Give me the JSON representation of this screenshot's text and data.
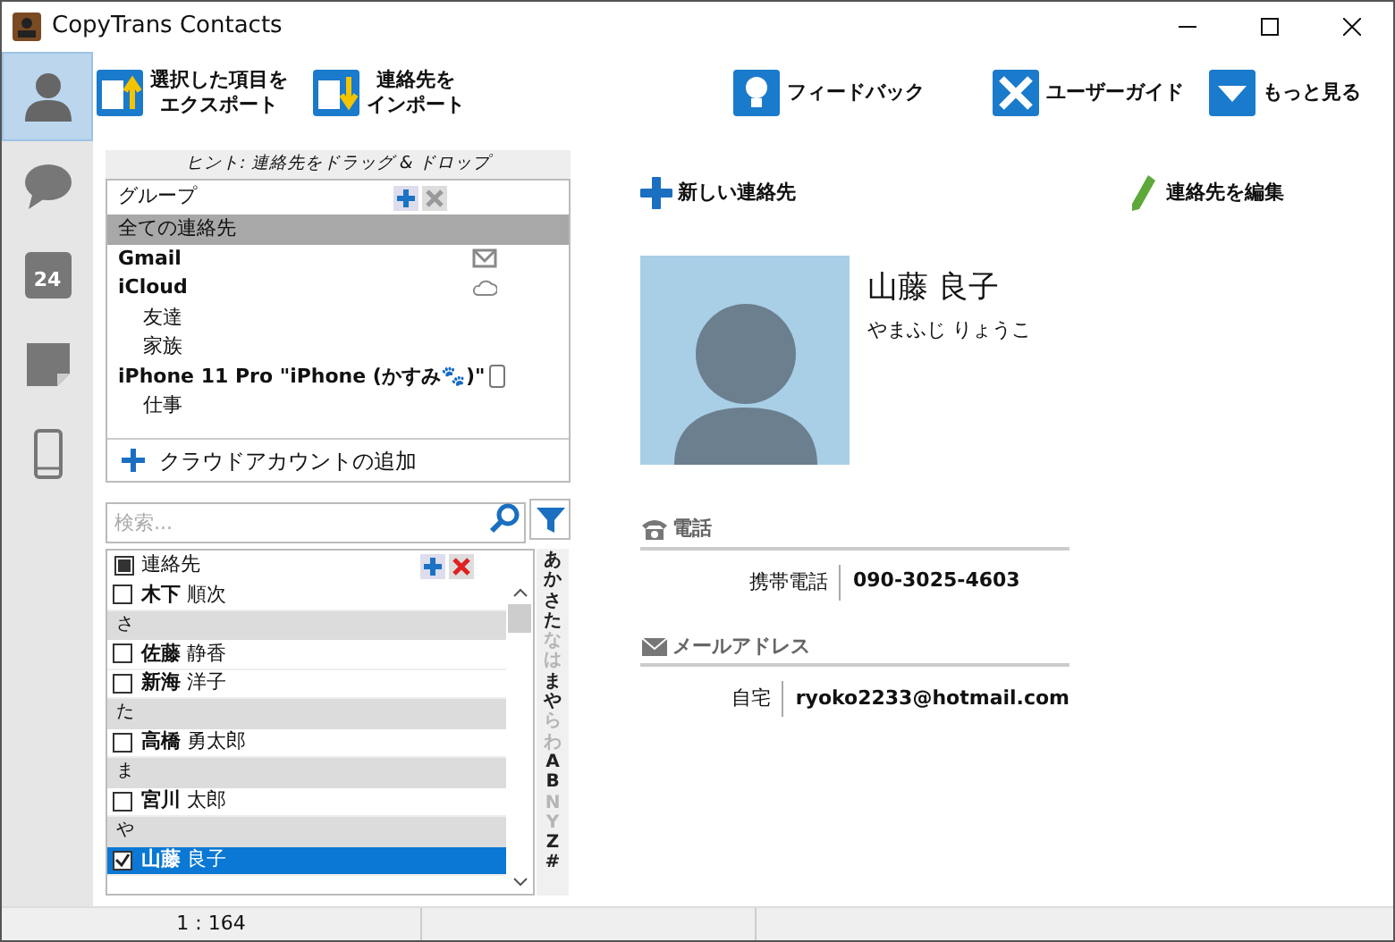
{
  "window": {
    "title": "CopyTrans Contacts"
  },
  "sidebar": {
    "items": [
      {
        "kind": "contacts",
        "selected": true
      },
      {
        "kind": "messages",
        "selected": false
      },
      {
        "kind": "calendar",
        "label": "24",
        "selected": false
      },
      {
        "kind": "notes",
        "selected": false
      },
      {
        "kind": "device",
        "selected": false
      }
    ]
  },
  "toolbar": {
    "buttons": [
      {
        "kind": "export",
        "lines": [
          "選択した項目を",
          "エクスポート"
        ]
      },
      {
        "kind": "import",
        "lines": [
          "連絡先を",
          "インポート"
        ]
      },
      {
        "kind": "feedback",
        "lines": [
          "フィードバック"
        ]
      },
      {
        "kind": "guide",
        "lines": [
          "ユーザーガイド"
        ]
      },
      {
        "kind": "more",
        "lines": [
          "もっと見る"
        ]
      }
    ]
  },
  "groups": {
    "hint": "ヒント: 連絡先をドラッグ & ドロップ",
    "header": "グループ",
    "items": [
      {
        "kind": "all",
        "label": "全ての連絡先",
        "selected": true
      },
      {
        "kind": "mail",
        "label": "Gmail",
        "selected": false
      },
      {
        "kind": "cloud",
        "label": "iCloud",
        "selected": false,
        "children": [
          {
            "label": "友達",
            "selected": false
          },
          {
            "label": "家族",
            "selected": false
          }
        ]
      },
      {
        "kind": "device",
        "label": "iPhone 11 Pro \"iPhone (かすみ🐾)\"",
        "selected": false,
        "children": [
          {
            "label": "仕事",
            "selected": false
          }
        ]
      }
    ],
    "add_account": "クラウドアカウントの追加"
  },
  "search": {
    "placeholder": "検索..."
  },
  "contacts": {
    "header": "連絡先",
    "header_partial": true,
    "rows": [
      {
        "kind": "contact",
        "name": "**木下** 順次",
        "checked": false,
        "selected": false
      },
      {
        "kind": "section",
        "label": "さ"
      },
      {
        "kind": "contact",
        "name": "**佐藤** 静香",
        "checked": false,
        "selected": false
      },
      {
        "kind": "contact",
        "name": "**新海** 洋子",
        "checked": false,
        "selected": false
      },
      {
        "kind": "section",
        "label": "た"
      },
      {
        "kind": "contact",
        "name": "**高橋** 勇太郎",
        "checked": false,
        "selected": false
      },
      {
        "kind": "section",
        "label": "ま"
      },
      {
        "kind": "contact",
        "name": "**宮川** 太郎",
        "checked": false,
        "selected": false
      },
      {
        "kind": "section",
        "label": "や"
      },
      {
        "kind": "contact",
        "name": "**山藤** 良子",
        "checked": true,
        "selected": true
      }
    ]
  },
  "index": [
    {
      "label": "あ",
      "enabled": true
    },
    {
      "label": "か",
      "enabled": true
    },
    {
      "label": "さ",
      "enabled": true
    },
    {
      "label": "た",
      "enabled": true
    },
    {
      "label": "な",
      "enabled": false
    },
    {
      "label": "は",
      "enabled": false
    },
    {
      "label": "ま",
      "enabled": true
    },
    {
      "label": "や",
      "enabled": true
    },
    {
      "label": "ら",
      "enabled": false
    },
    {
      "label": "わ",
      "enabled": false
    },
    {
      "label": "A",
      "enabled": true
    },
    {
      "label": "B",
      "enabled": true
    },
    {
      "label": "N",
      "enabled": false
    },
    {
      "label": "Y",
      "enabled": false
    },
    {
      "label": "Z",
      "enabled": true
    },
    {
      "label": "#",
      "enabled": true
    }
  ],
  "detail": {
    "new_contact": "新しい連絡先",
    "edit_contact": "連絡先を編集",
    "name": "山藤 良子",
    "reading": "やまふじ りょうこ",
    "sections": [
      {
        "kind": "phone",
        "title": "電話",
        "fields": [
          {
            "label": "携帯電話",
            "value": "090-3025-4603"
          }
        ]
      },
      {
        "kind": "mail",
        "title": "メールアドレス",
        "fields": [
          {
            "label": "自宅",
            "value": "ryoko2233@hotmail.com"
          }
        ]
      }
    ]
  },
  "status_bar": {
    "text": "1 : 164"
  }
}
